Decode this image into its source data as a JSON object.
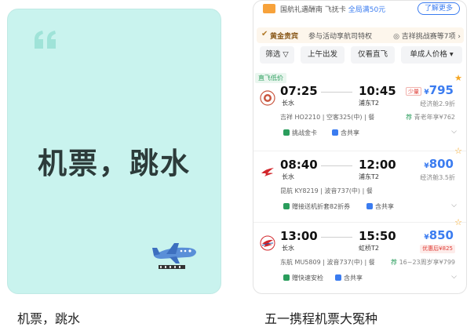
{
  "left_post": {
    "cover_title": "机票，跳水",
    "caption": "机票，跳水",
    "quote_icon": "quote-icon",
    "sticker_icon": "airplane-icon"
  },
  "right_post": {
    "caption": "五一携程机票大冤种",
    "promo": {
      "text_a": "国航礼遇酬南 飞抚卡 ",
      "text_b": "全局满50元",
      "more_label": "了解更多"
    },
    "vip": {
      "label": "黄金贵宾",
      "desc": "参与活动享航司特权",
      "right": "◎ 吉祥挑战赛等7项 ›"
    },
    "filters": [
      "筛选 ▽",
      "上午出发",
      "仅看直飞",
      "单成人价格 ▾"
    ],
    "direct_tag": "直飞低价",
    "flights": [
      {
        "dep_time": "07:25",
        "arr_time": "10:45",
        "dep_airport": "长水",
        "arr_airport": "浦东T2",
        "low_tag": "少量",
        "price": "795",
        "cabin": "经济舱2.9折",
        "meta": "吉祥 HO2210 | 空客325(中) | 餐",
        "senior_tag": "荐",
        "senior": " 青老年享¥762",
        "benefits": [
          {
            "text": "挑战金卡",
            "color": "#2a9d5c"
          }
        ],
        "benefit2": {
          "text": "含共享",
          "color": "#3b7cf0"
        },
        "logo": "juneyao-logo-icon"
      },
      {
        "dep_time": "08:40",
        "arr_time": "12:00",
        "dep_airport": "长水",
        "arr_airport": "浦东T2",
        "price": "800",
        "cabin": "经济舱3.5折",
        "meta": "昆航 KY8219 | 波音737(中) | 餐",
        "benefits": [
          {
            "text": "赠接送机折套82折券",
            "color": "#2a9d5c"
          }
        ],
        "benefit2": {
          "text": "含共享",
          "color": "#3b7cf0"
        },
        "logo": "kunming-airlines-logo-icon"
      },
      {
        "dep_time": "13:00",
        "arr_time": "15:50",
        "dep_airport": "长水",
        "arr_airport": "虹桥T2",
        "price": "850",
        "promo_price": "优惠后¥825",
        "meta": "东航 MU5809 | 波音737(中) | 餐",
        "senior_tag": "荐",
        "senior": " 16~23周岁享¥799",
        "benefits": [
          {
            "text": "赠快速安检",
            "color": "#2a9d5c"
          }
        ],
        "benefit2": {
          "text": "含共享",
          "color": "#3b7cf0"
        },
        "logo": "china-eastern-logo-icon"
      }
    ]
  },
  "colors": {
    "cover_bg": "#c9f3ee",
    "price_blue": "#3b7cf0",
    "accent_green": "#2a9d5c",
    "accent_red": "#e0413a"
  }
}
